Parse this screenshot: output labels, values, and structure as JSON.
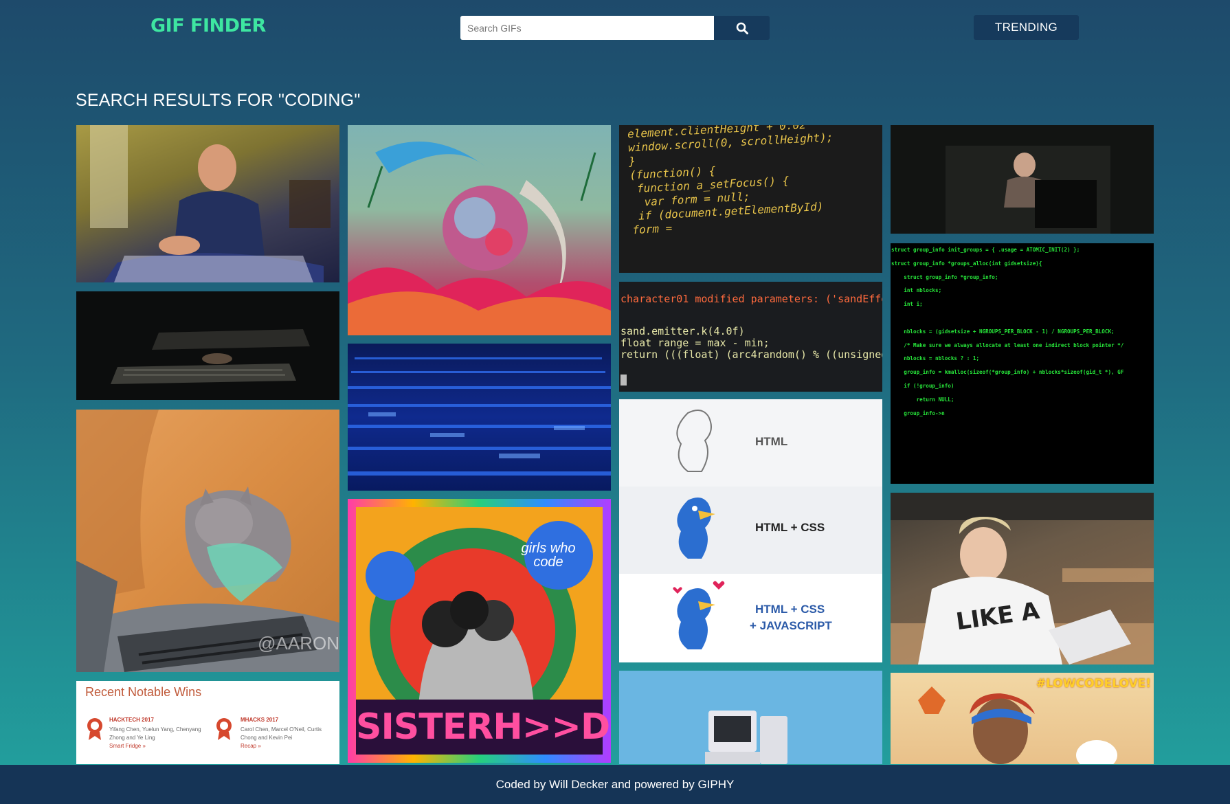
{
  "header": {
    "logo": "GIF FINDER",
    "search_placeholder": "Search GIFs",
    "trending_label": "TRENDING"
  },
  "results": {
    "heading": "SEARCH RESULTS FOR \"CODING\""
  },
  "gif_text": {
    "code_snippet": " element.clientHeight + 0.02\n window.scroll(0, scrollHeight);\n }\n (function() {\n  function a_setFocus() {\n   var form = null;\n  if (document.getElementById)\n form =",
    "sand_code_top": "character01 modified parameters: ('sandEffe",
    "sand_code_bottom": "sand.emitter.k(4.0f)\nfloat range = max - min;\nreturn (((float) (arc4random() % ((unsigned",
    "kernel_code": "struct group_info init_groups = { .usage = ATOMIC_INIT(2) };\nstruct group_info *groups_alloc(int gidsetsize){\n    struct group_info *group_info;\n    int nblocks;\n    int i;\n\n    nblocks = (gidsetsize + NGROUPS_PER_BLOCK - 1) / NGROUPS_PER_BLOCK;\n    /* Make sure we always allocate at least one indirect block pointer */\n    nblocks = nblocks ? : 1;\n    group_info = kmalloc(sizeof(*group_info) + nblocks*sizeof(gid_t *), GF\n    if (!group_info)\n        return NULL;\n    group_info->n",
    "html_1": "HTML",
    "html_2": "HTML + CSS",
    "html_3a": "HTML + CSS",
    "html_3b": "+ JAVASCRIPT",
    "watermark": "@AARON",
    "wins_title": "Recent Notable Wins",
    "win1_name": "HACKTECH 2017",
    "win1_people": "Yifang Chen, Yuelun Yang, Chenyang\nZhong and Ye Ling",
    "win1_link": "Smart Fridge »",
    "win2_name": "MHACKS 2017",
    "win2_people": "Carol Chen, Marcel O'Neil, Curtis\nChong and Kevin Pei",
    "win2_link": "Recap »",
    "sister_brand": "girls who code",
    "sister_word": "SISTERH>>D",
    "lowcode": "#LOWCODELOVE!",
    "shirt": "LIKE A"
  },
  "footer": {
    "credit": "Coded by Will Decker and powered by GIPHY"
  }
}
